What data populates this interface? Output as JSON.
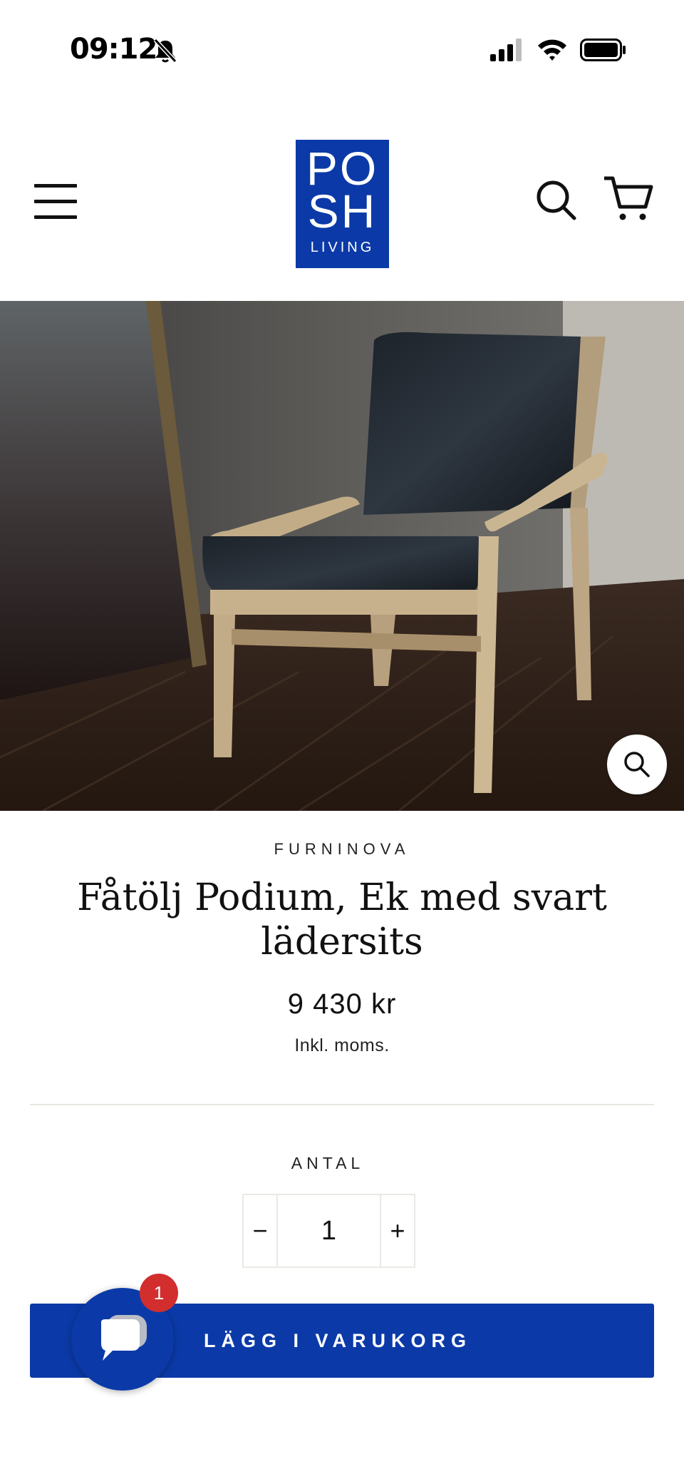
{
  "status_bar": {
    "time": "09:12"
  },
  "header": {
    "logo_lines": [
      "PO",
      "SH",
      "LIVING"
    ],
    "icons": [
      "menu-icon",
      "search-icon",
      "cart-icon"
    ]
  },
  "product": {
    "vendor": "FURNINOVA",
    "title": "Fåtölj Podium, Ek med svart lädersits",
    "price": "9 430 kr",
    "tax_note": "Inkl. moms.",
    "quantity_label": "ANTAL",
    "quantity": "1",
    "minus": "−",
    "plus": "+",
    "add_to_cart": "LÄGG I VARUKORG"
  },
  "chat": {
    "badge": "1"
  },
  "colors": {
    "brand": "#0b3aa8",
    "badge": "#d22e2e"
  }
}
